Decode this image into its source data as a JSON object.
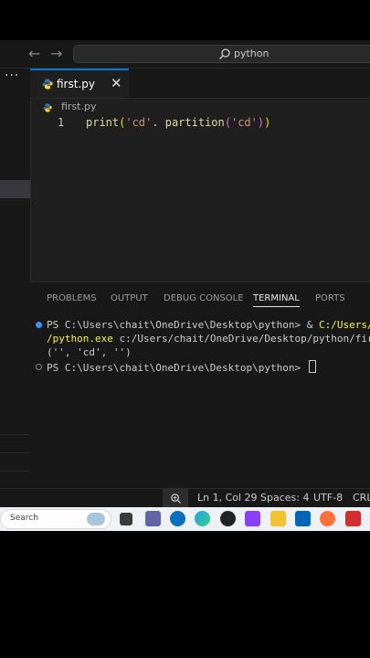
{
  "titlebar": {
    "back_arrow": "←",
    "forward_arrow": "→",
    "search_text": "python",
    "search_icon": "search-icon"
  },
  "sidebar": {
    "more": "···"
  },
  "tab": {
    "label": "first.py",
    "close": "✕",
    "icon": "python-file-icon"
  },
  "breadcrumb": {
    "file": "first.py"
  },
  "editor": {
    "line_number": "1",
    "code": {
      "fn": "print",
      "open1": "(",
      "arg1": "'cd'",
      "dot": ". ",
      "method": "partition",
      "open2": "(",
      "arg2": "'cd'",
      "close2": ")",
      "close1": ")"
    }
  },
  "panel": {
    "tabs": [
      "PROBLEMS",
      "OUTPUT",
      "DEBUG CONSOLE",
      "TERMINAL",
      "PORTS"
    ],
    "active_tab": "TERMINAL",
    "terminal": {
      "line1_prompt": "PS C:\\Users\\chait\\OneDrive\\Desktop\\python> & ",
      "line1_path": "C:/Users/chait",
      "line2_exe": "/python.exe",
      "line2_rest": " c:/Users/chait/OneDrive/Desktop/python/first.py",
      "line3_output": "('', 'cd', '')",
      "line4_prompt": "PS C:\\Users\\chait\\OneDrive\\Desktop\\python> "
    }
  },
  "statusbar": {
    "position": "Ln 1, Col 29",
    "spaces": "Spaces: 4",
    "encoding": "UTF-8",
    "eol": "CRLF"
  },
  "taskbar": {
    "search_placeholder": "Search"
  },
  "colors": {
    "accent": "#0078d4",
    "python_blue": "#3572a5",
    "python_yellow": "#ffd43b"
  }
}
